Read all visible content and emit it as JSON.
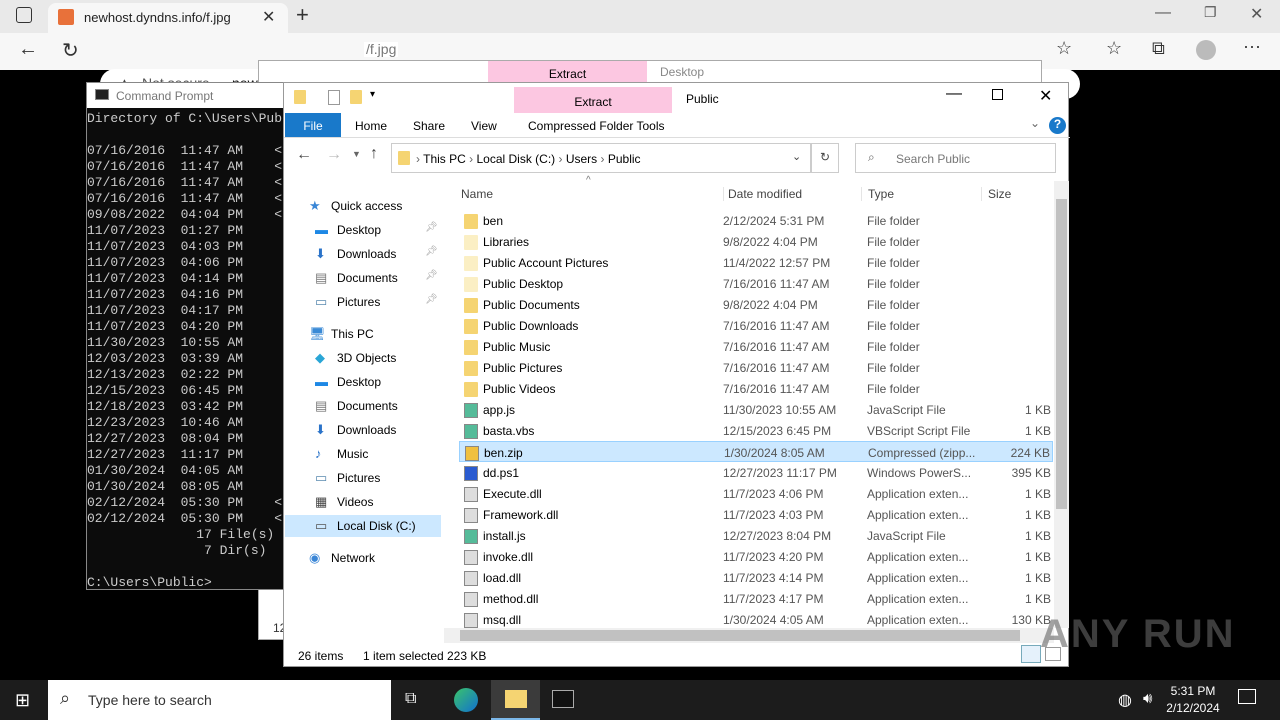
{
  "browser": {
    "tab_title": "newhost.dyndns.info/f.jpg",
    "security": "Not secure",
    "url_host": "newhost.dyndns.info",
    "url_path": "/f.jpg"
  },
  "bg_window": {
    "extract": "Extract",
    "title": "Desktop",
    "status_fragment": "12"
  },
  "cmd": {
    "title": "Command Prompt",
    "lines": [
      "Directory of C:\\Users\\Public",
      "",
      "07/16/2016  11:47 AM    <",
      "07/16/2016  11:47 AM    <",
      "07/16/2016  11:47 AM    <",
      "07/16/2016  11:47 AM    <",
      "09/08/2022  04:04 PM    <",
      "11/07/2023  01:27 PM",
      "11/07/2023  04:03 PM",
      "11/07/2023  04:06 PM",
      "11/07/2023  04:14 PM",
      "11/07/2023  04:16 PM",
      "11/07/2023  04:17 PM",
      "11/07/2023  04:20 PM",
      "11/30/2023  10:55 AM",
      "12/03/2023  03:39 AM",
      "12/13/2023  02:22 PM",
      "12/15/2023  06:45 PM",
      "12/18/2023  03:42 PM",
      "12/23/2023  10:46 AM",
      "12/27/2023  08:04 PM",
      "12/27/2023  11:17 PM",
      "01/30/2024  04:05 AM",
      "01/30/2024  08:05 AM",
      "02/12/2024  05:30 PM    <",
      "02/12/2024  05:30 PM    <",
      "              17 File(s)",
      "               7 Dir(s)",
      "",
      "C:\\Users\\Public>"
    ]
  },
  "explorer": {
    "extract": "Extract",
    "title": "Public",
    "ribbon_tabs": [
      "File",
      "Home",
      "Share",
      "View"
    ],
    "contextual_tab": "Compressed Folder Tools",
    "breadcrumb": [
      "This PC",
      "Local Disk (C:)",
      "Users",
      "Public"
    ],
    "search_placeholder": "Search Public",
    "nav": [
      {
        "label": "Quick access",
        "icon": "star",
        "indent": 0,
        "pin": false
      },
      {
        "label": "Desktop",
        "icon": "desktop",
        "indent": 1,
        "pin": true
      },
      {
        "label": "Downloads",
        "icon": "download",
        "indent": 1,
        "pin": true
      },
      {
        "label": "Documents",
        "icon": "document",
        "indent": 1,
        "pin": true
      },
      {
        "label": "Pictures",
        "icon": "picture",
        "indent": 1,
        "pin": true
      },
      {
        "label": "This PC",
        "icon": "pc",
        "indent": 0,
        "pin": false,
        "gap": true
      },
      {
        "label": "3D Objects",
        "icon": "cube",
        "indent": 1
      },
      {
        "label": "Desktop",
        "icon": "desktop",
        "indent": 1
      },
      {
        "label": "Documents",
        "icon": "document",
        "indent": 1
      },
      {
        "label": "Downloads",
        "icon": "download",
        "indent": 1
      },
      {
        "label": "Music",
        "icon": "music",
        "indent": 1
      },
      {
        "label": "Pictures",
        "icon": "picture",
        "indent": 1
      },
      {
        "label": "Videos",
        "icon": "video",
        "indent": 1
      },
      {
        "label": "Local Disk (C:)",
        "icon": "drive",
        "indent": 1,
        "selected": true
      },
      {
        "label": "Network",
        "icon": "network",
        "indent": 0,
        "gap": true
      }
    ],
    "columns": [
      "Name",
      "Date modified",
      "Type",
      "Size"
    ],
    "files": [
      {
        "name": "ben",
        "date": "2/12/2024 5:31 PM",
        "type": "File folder",
        "size": "",
        "icon": "folder"
      },
      {
        "name": "Libraries",
        "date": "9/8/2022 4:04 PM",
        "type": "File folder",
        "size": "",
        "icon": "folder-pale"
      },
      {
        "name": "Public Account Pictures",
        "date": "11/4/2022 12:57 PM",
        "type": "File folder",
        "size": "",
        "icon": "folder-pale"
      },
      {
        "name": "Public Desktop",
        "date": "7/16/2016 11:47 AM",
        "type": "File folder",
        "size": "",
        "icon": "folder-pale"
      },
      {
        "name": "Public Documents",
        "date": "9/8/2022 4:04 PM",
        "type": "File folder",
        "size": "",
        "icon": "folder"
      },
      {
        "name": "Public Downloads",
        "date": "7/16/2016 11:47 AM",
        "type": "File folder",
        "size": "",
        "icon": "folder"
      },
      {
        "name": "Public Music",
        "date": "7/16/2016 11:47 AM",
        "type": "File folder",
        "size": "",
        "icon": "folder"
      },
      {
        "name": "Public Pictures",
        "date": "7/16/2016 11:47 AM",
        "type": "File folder",
        "size": "",
        "icon": "folder"
      },
      {
        "name": "Public Videos",
        "date": "7/16/2016 11:47 AM",
        "type": "File folder",
        "size": "",
        "icon": "folder"
      },
      {
        "name": "app.js",
        "date": "11/30/2023 10:55 AM",
        "type": "JavaScript File",
        "size": "1 KB",
        "icon": "script"
      },
      {
        "name": "basta.vbs",
        "date": "12/15/2023 6:45 PM",
        "type": "VBScript Script File",
        "size": "1 KB",
        "icon": "script"
      },
      {
        "name": "ben.zip",
        "date": "1/30/2024 8:05 AM",
        "type": "Compressed (zipp...",
        "size": "224 KB",
        "icon": "zip",
        "selected": true
      },
      {
        "name": "dd.ps1",
        "date": "12/27/2023 11:17 PM",
        "type": "Windows PowerS...",
        "size": "395 KB",
        "icon": "powershell"
      },
      {
        "name": "Execute.dll",
        "date": "11/7/2023 4:06 PM",
        "type": "Application exten...",
        "size": "1 KB",
        "icon": "dll"
      },
      {
        "name": "Framework.dll",
        "date": "11/7/2023 4:03 PM",
        "type": "Application exten...",
        "size": "1 KB",
        "icon": "dll"
      },
      {
        "name": "install.js",
        "date": "12/27/2023 8:04 PM",
        "type": "JavaScript File",
        "size": "1 KB",
        "icon": "script"
      },
      {
        "name": "invoke.dll",
        "date": "11/7/2023 4:20 PM",
        "type": "Application exten...",
        "size": "1 KB",
        "icon": "dll"
      },
      {
        "name": "load.dll",
        "date": "11/7/2023 4:14 PM",
        "type": "Application exten...",
        "size": "1 KB",
        "icon": "dll"
      },
      {
        "name": "method.dll",
        "date": "11/7/2023 4:17 PM",
        "type": "Application exten...",
        "size": "1 KB",
        "icon": "dll"
      },
      {
        "name": "msq.dll",
        "date": "1/30/2024 4:05 AM",
        "type": "Application exten...",
        "size": "130 KB",
        "icon": "dll"
      }
    ],
    "status": {
      "items": "26 items",
      "selected": "1 item selected",
      "size": "223 KB"
    }
  },
  "taskbar": {
    "search_placeholder": "Type here to search",
    "time": "5:31 PM",
    "date": "2/12/2024"
  },
  "watermark": "ANY RUN"
}
